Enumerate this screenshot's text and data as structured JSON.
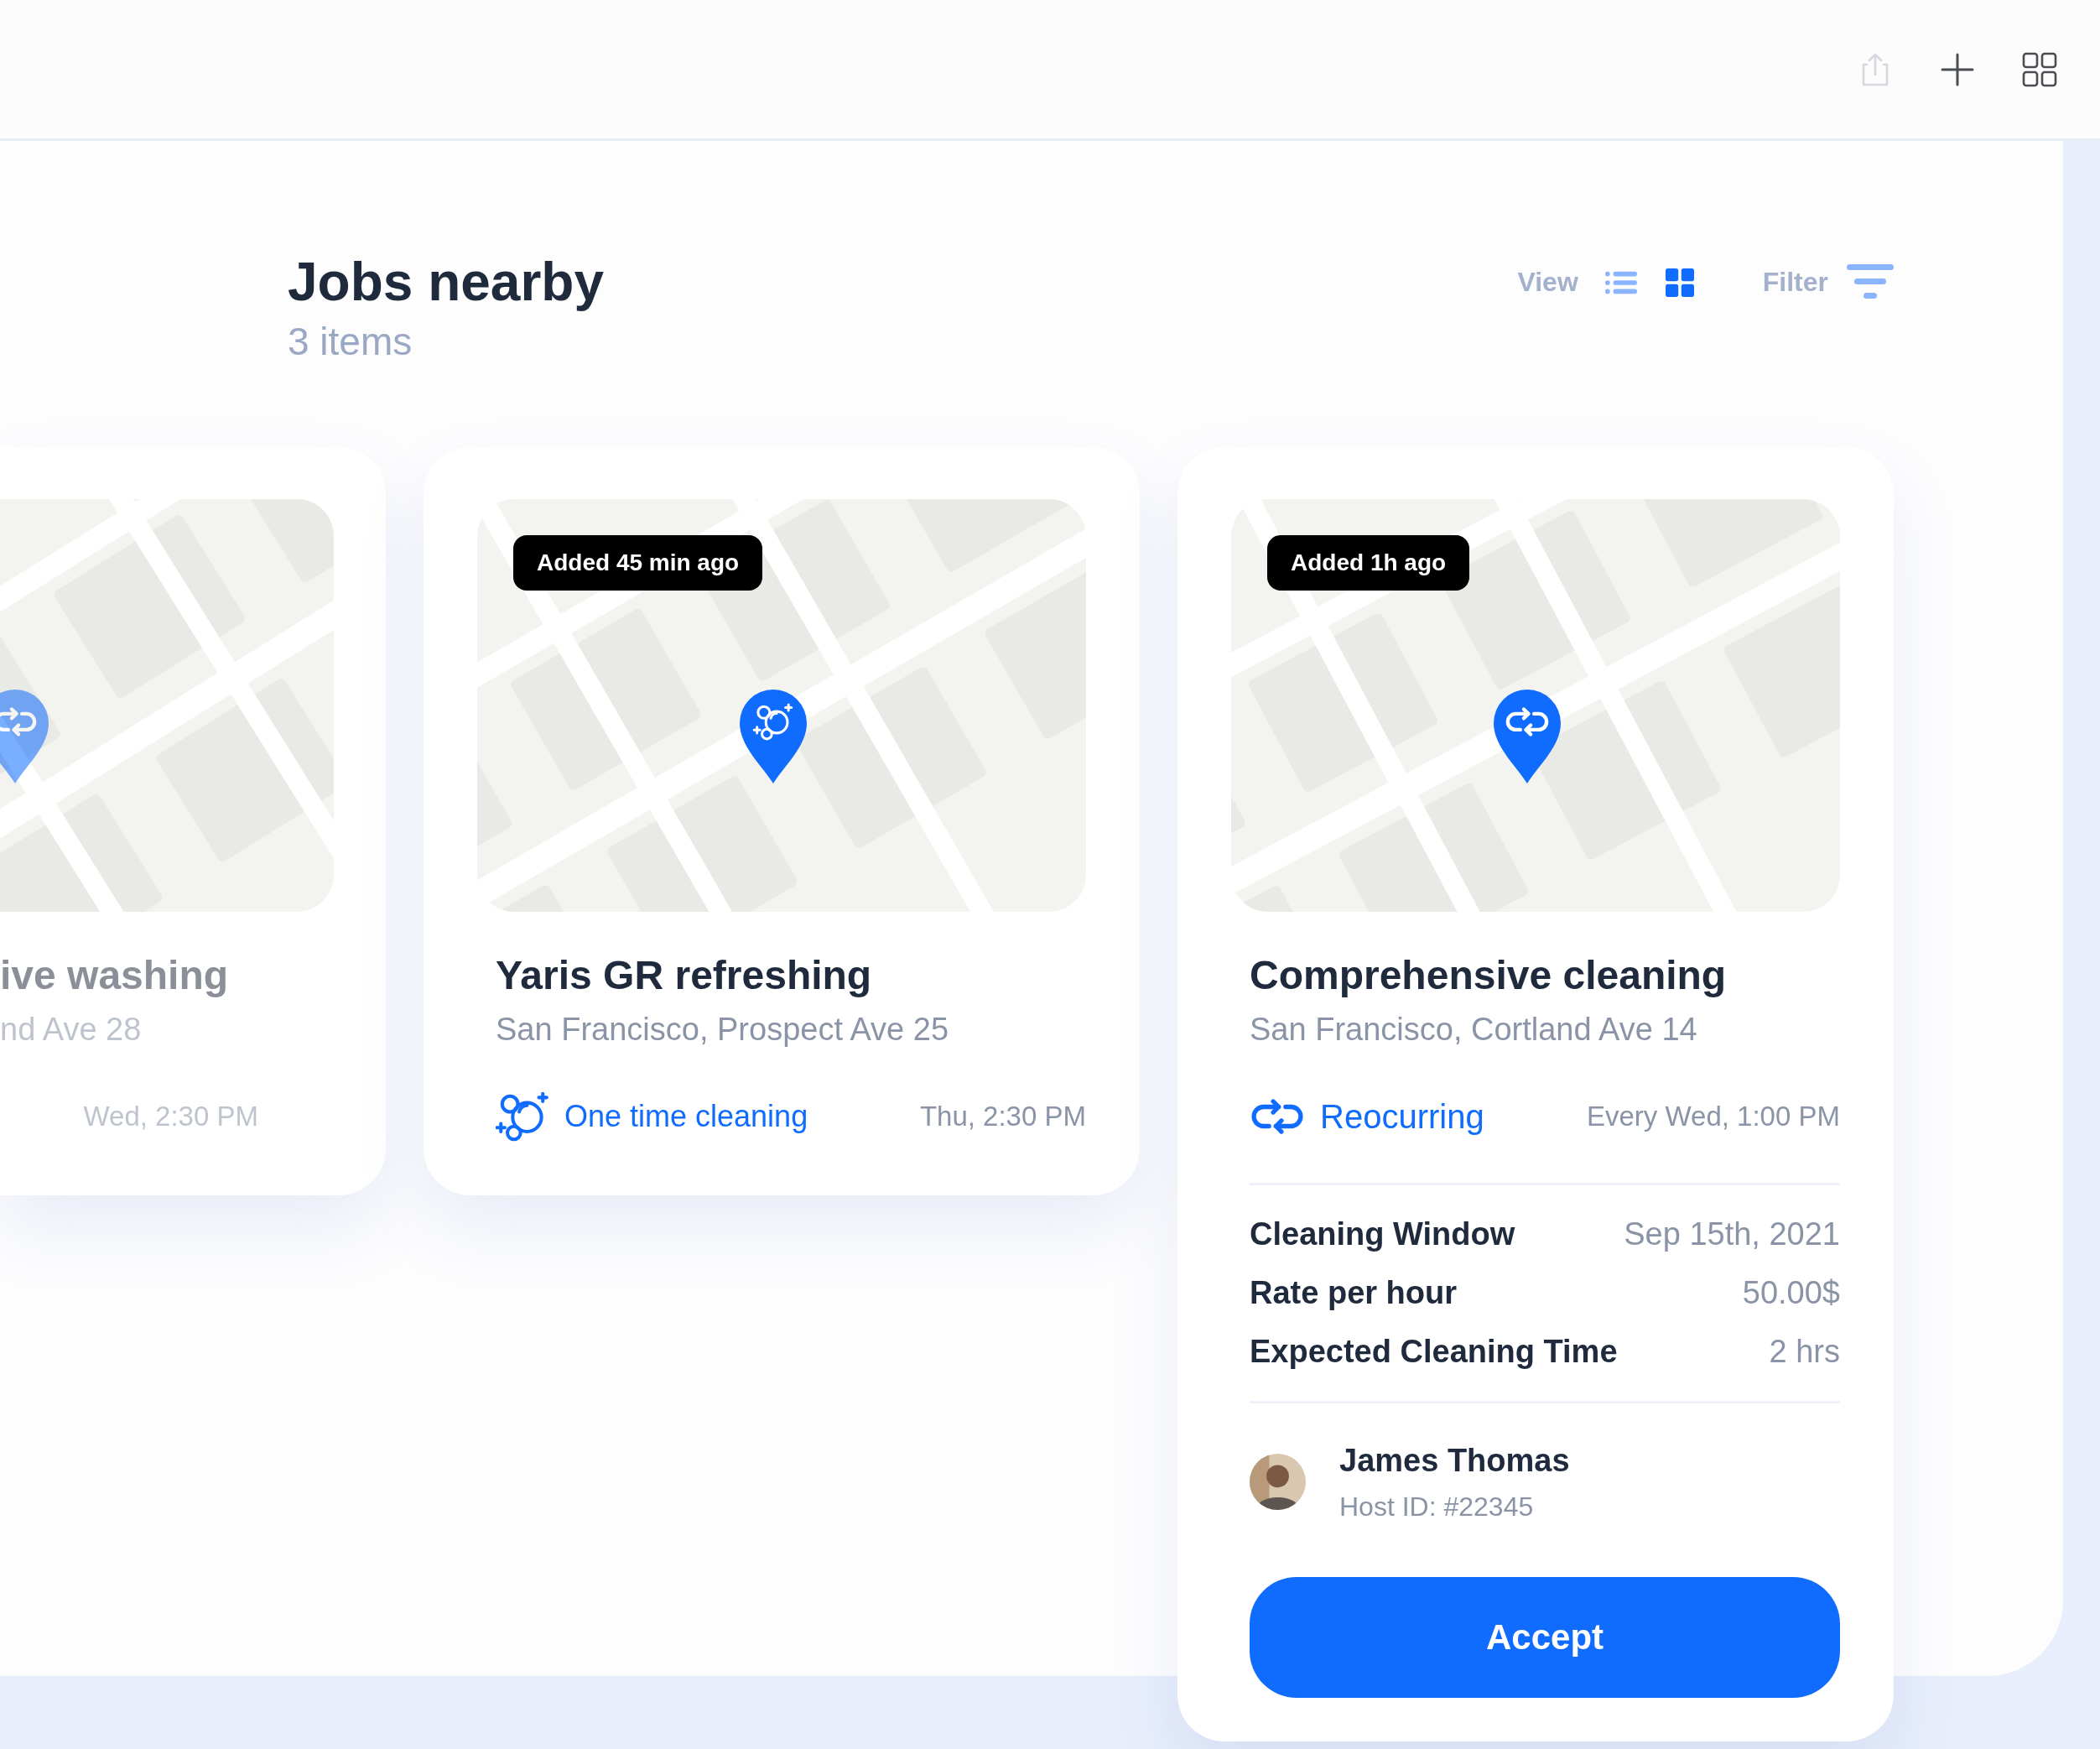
{
  "toolbar": [
    {
      "kind": "share",
      "disabled": true
    },
    {
      "kind": "add",
      "disabled": false
    },
    {
      "kind": "apps",
      "disabled": false
    }
  ],
  "header": {
    "title": "Jobs nearby",
    "count": "3 items",
    "view_label": "View",
    "view_options": [
      {
        "kind": "list",
        "selected": false
      },
      {
        "kind": "grid",
        "selected": true
      }
    ],
    "filter_label": "Filter"
  },
  "jobs": [
    {
      "kind": "partial",
      "pin": {
        "kind": "recurring"
      },
      "title": "ive washing",
      "address": "nd Ave 28",
      "time": "Wed, 2:30 PM"
    },
    {
      "kind": "compact",
      "pin": {
        "kind": "one_time"
      },
      "badge": "Added 45 min ago",
      "title": "Yaris GR refreshing",
      "address": "San Francisco, Prospect Ave 25",
      "tag": {
        "kind": "one_time",
        "label": "One time cleaning"
      },
      "time": "Thu, 2:30 PM"
    },
    {
      "kind": "detailed",
      "pin": {
        "kind": "recurring"
      },
      "badge": "Added 1h ago",
      "title": "Comprehensive cleaning",
      "address": "San Francisco, Cortland Ave 14",
      "tag": {
        "kind": "recurring",
        "label": "Reocurring"
      },
      "time": "Every Wed, 1:00 PM",
      "details": [
        {
          "label": "Cleaning Window",
          "value": "Sep 15th, 2021"
        },
        {
          "label": "Rate per hour",
          "value": "50.00$"
        },
        {
          "label": "Expected Cleaning Time",
          "value": "2 hrs"
        }
      ],
      "host": {
        "name": "James Thomas",
        "id": "Host ID: #22345"
      },
      "action": "Accept"
    }
  ]
}
